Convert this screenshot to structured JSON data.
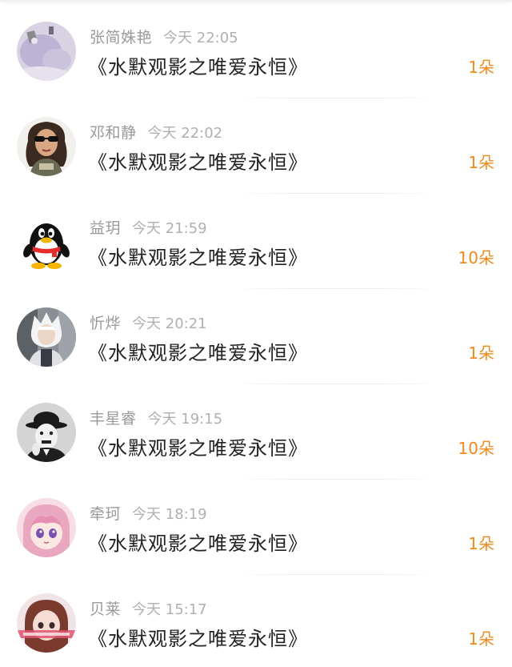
{
  "rows": [
    {
      "name": "张简姝艳",
      "time": "今天 22:05",
      "title": "《水默观影之唯爱永恒》",
      "count": "1朵",
      "avatar": "abstract-painting"
    },
    {
      "name": "邓和静",
      "time": "今天 22:02",
      "title": "《水默观影之唯爱永恒》",
      "count": "1朵",
      "avatar": "woman-sunglasses"
    },
    {
      "name": "益玥",
      "time": "今天 21:59",
      "title": "《水默观影之唯爱永恒》",
      "count": "10朵",
      "avatar": "qq-penguin"
    },
    {
      "name": "忻烨",
      "time": "今天 20:21",
      "title": "《水默观影之唯爱永恒》",
      "count": "1朵",
      "avatar": "white-hair-cosplay"
    },
    {
      "name": "丰星睿",
      "time": "今天 19:15",
      "title": "《水默观影之唯爱永恒》",
      "count": "10朵",
      "avatar": "bowler-hat-man"
    },
    {
      "name": "牵珂",
      "time": "今天 18:19",
      "title": "《水默观影之唯爱永恒》",
      "count": "1朵",
      "avatar": "anime-girl"
    },
    {
      "name": "贝莱",
      "time": "今天 15:17",
      "title": "《水默观影之唯爱永恒》",
      "count": "1朵",
      "avatar": "doll-girl"
    }
  ],
  "colors": {
    "name": "#9a9a9a",
    "time": "#b0b0b0",
    "title": "#222222",
    "count": "#f08a1c"
  }
}
